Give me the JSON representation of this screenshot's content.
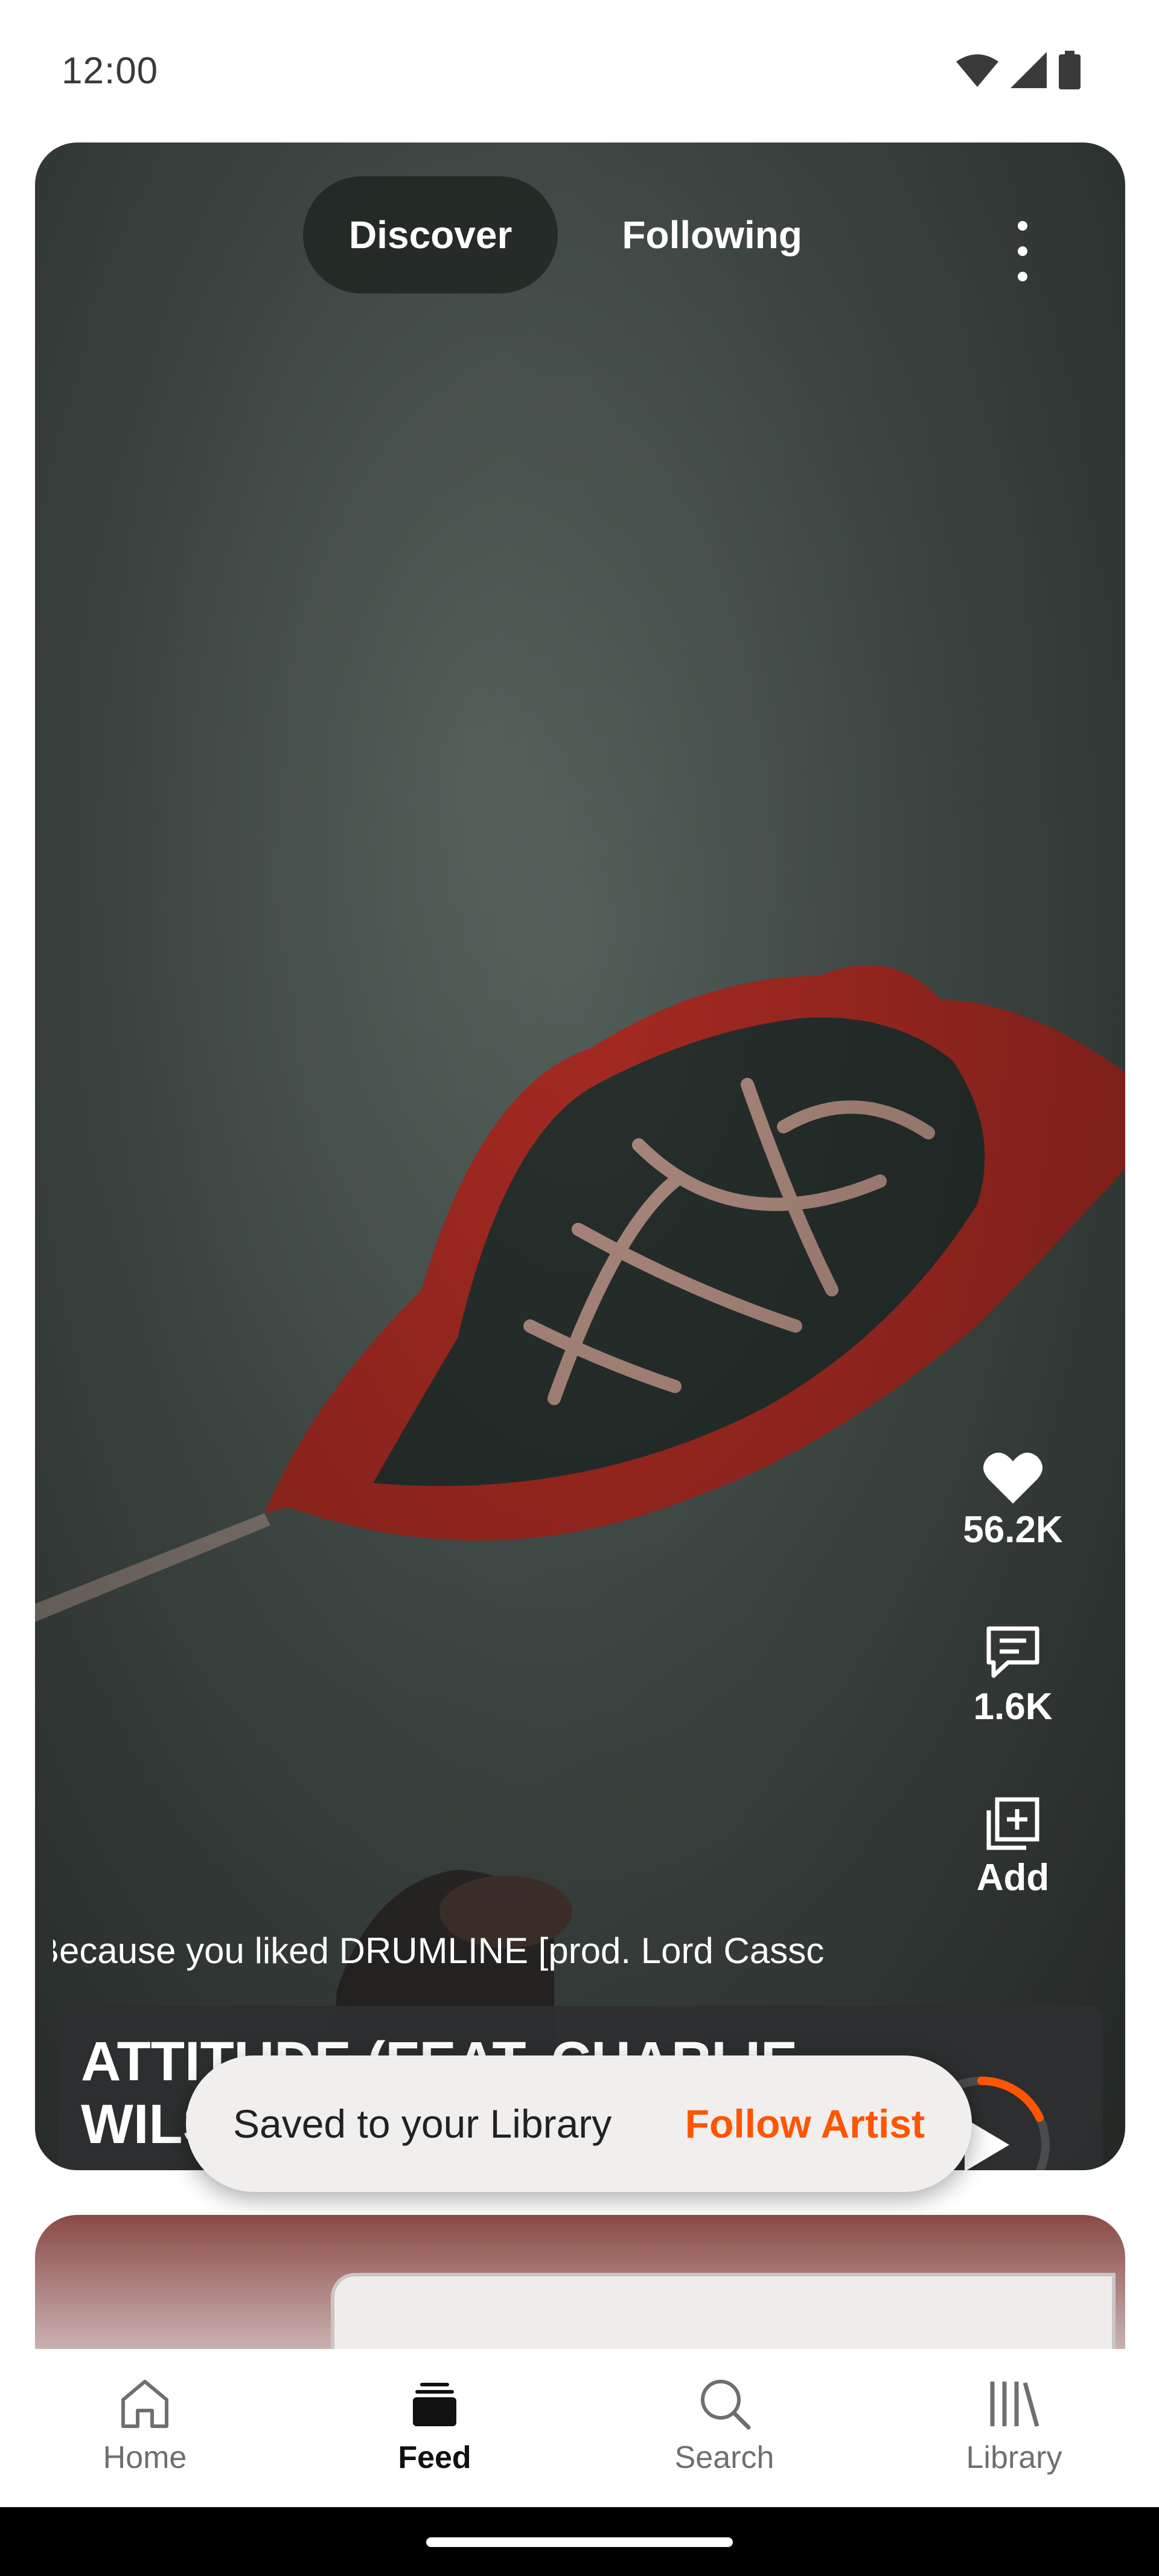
{
  "status_bar": {
    "time": "12:00",
    "icons": [
      "wifi-icon",
      "signal-icon",
      "battery-icon"
    ]
  },
  "feed": {
    "tabs": [
      {
        "label": "Discover",
        "active": true
      },
      {
        "label": "Following",
        "active": false
      }
    ],
    "actions": {
      "like_count": "56.2K",
      "comment_count": "1.6K",
      "add_label": "Add"
    },
    "reason": "Because you liked DRUMLINE [prod. Lord Cassc",
    "track": {
      "title": "ATTITUDE (FEAT. CHARLIE WILSON & CASH COBAIN)",
      "play_progress": 0.18
    }
  },
  "toast": {
    "message": "Saved to your Library",
    "action": "Follow Artist"
  },
  "bottom_nav": {
    "items": [
      {
        "label": "Home",
        "icon": "home-icon",
        "active": false
      },
      {
        "label": "Feed",
        "icon": "feed-icon",
        "active": true
      },
      {
        "label": "Search",
        "icon": "search-icon",
        "active": false
      },
      {
        "label": "Library",
        "icon": "library-icon",
        "active": false
      }
    ]
  },
  "colors": {
    "accent": "#ff5500",
    "card_bg": "#4a5450",
    "flag_red": "#a52a22"
  }
}
